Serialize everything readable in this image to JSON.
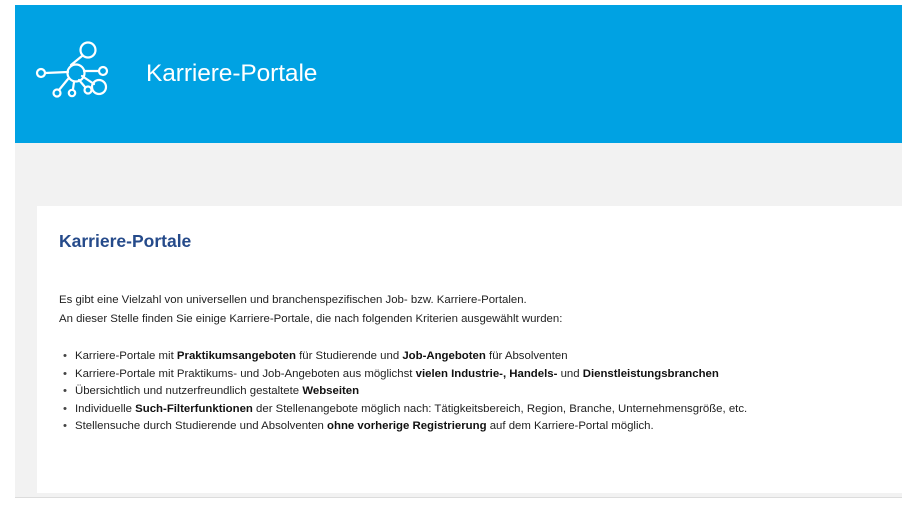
{
  "banner": {
    "title": "Karriere-Portale",
    "logo_icon": "network-nodes-icon",
    "background": "#00a2e3"
  },
  "card": {
    "heading": "Karriere-Portale",
    "heading_color": "#254a8a",
    "intro": [
      "Es gibt eine Vielzahl von universellen und branchenspezifischen Job- bzw. Karriere-Portalen.",
      "An dieser Stelle finden Sie einige Karriere-Portale, die nach folgenden Kriterien ausgewählt wurden:"
    ],
    "bullet_symbol": "•",
    "criteria": [
      [
        {
          "t": "Karriere-Portale mit ",
          "b": false
        },
        {
          "t": "Praktikumsangeboten",
          "b": true
        },
        {
          "t": " für Studierende und ",
          "b": false
        },
        {
          "t": "Job-Angeboten",
          "b": true
        },
        {
          "t": " für Absolventen",
          "b": false
        }
      ],
      [
        {
          "t": "Karriere-Portale mit Praktikums- und Job-Angeboten aus möglichst ",
          "b": false
        },
        {
          "t": "vielen Industrie-, Handels-",
          "b": true
        },
        {
          "t": " und ",
          "b": false
        },
        {
          "t": "Dienstleistungsbranchen",
          "b": true
        }
      ],
      [
        {
          "t": "Übersichtlich und nutzerfreundlich gestaltete ",
          "b": false
        },
        {
          "t": "Webseiten",
          "b": true
        }
      ],
      [
        {
          "t": "Individuelle ",
          "b": false
        },
        {
          "t": "Such-Filterfunktionen",
          "b": true
        },
        {
          "t": " der Stellenangebote möglich nach: Tätigkeitsbereich, Region, Branche, Unternehmensgröße, etc.",
          "b": false
        }
      ],
      [
        {
          "t": "Stellensuche durch Studierende und Absolventen ",
          "b": false
        },
        {
          "t": "ohne vorherige Registrierung",
          "b": true
        },
        {
          "t": " auf dem Karriere-Portal möglich.",
          "b": false
        }
      ]
    ]
  }
}
